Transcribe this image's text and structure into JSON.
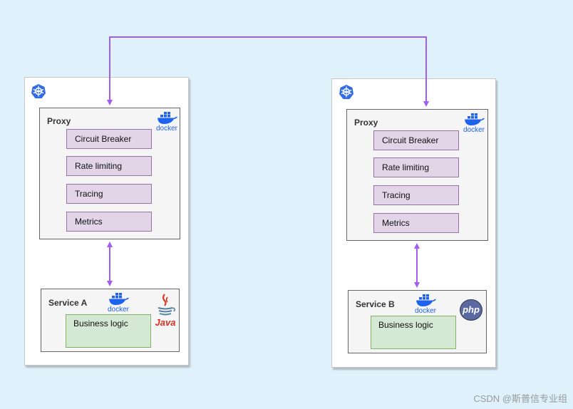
{
  "colors": {
    "background": "#dff1fa",
    "arrow": "#a35cf0",
    "feature_fill": "#e1d5e7",
    "feature_border": "#9673a6",
    "business_fill": "#d5e8d4",
    "business_border": "#82b366",
    "kubernetes_blue": "#326ce5",
    "docker_blue": "#1d63ed",
    "java_red": "#e0301e"
  },
  "icons": {
    "kubernetes": "kubernetes-icon",
    "docker": "docker-icon",
    "java": "java-logo",
    "php": "php-logo"
  },
  "left": {
    "proxy": {
      "title": "Proxy",
      "docker_label": "docker",
      "features": [
        "Circuit Breaker",
        "Rate limiting",
        "Tracing",
        "Metrics"
      ]
    },
    "service": {
      "title": "Service A",
      "docker_label": "docker",
      "language_label": "Java",
      "logic_label": "Business logic"
    }
  },
  "right": {
    "proxy": {
      "title": "Proxy",
      "docker_label": "docker",
      "features": [
        "Circuit Breaker",
        "Rate limiting",
        "Tracing",
        "Metrics"
      ]
    },
    "service": {
      "title": "Service B",
      "docker_label": "docker",
      "language_label": "php",
      "logic_label": "Business logic"
    }
  },
  "watermark": "CSDN @斯普信专业组"
}
